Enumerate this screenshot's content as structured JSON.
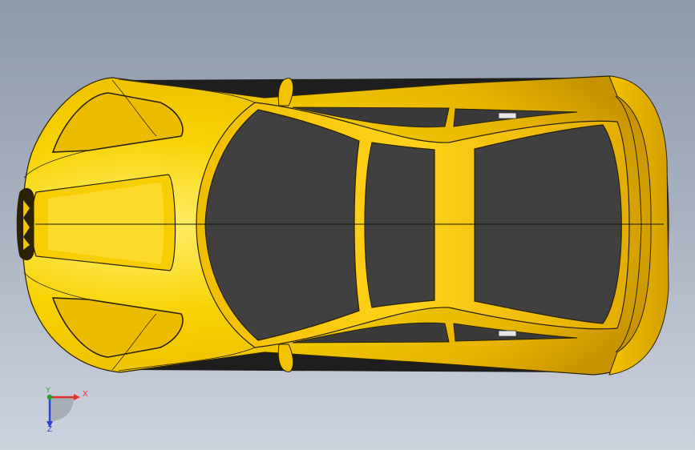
{
  "scene": {
    "model_type": "sports-car-top-view",
    "colors": {
      "background_top": "#8d98aa",
      "background_bottom": "#cdd3dd",
      "body": "#f2c400",
      "body_highlight": "#fff176",
      "body_shadow": "#b88400",
      "glass": "#404040",
      "edge": "#2a2200"
    }
  },
  "triad": {
    "x_label": "X",
    "y_label": "Y",
    "z_label": "Z",
    "x_color": "#e03030",
    "y_color": "#2aa02a",
    "z_color": "#2a3fd0"
  }
}
